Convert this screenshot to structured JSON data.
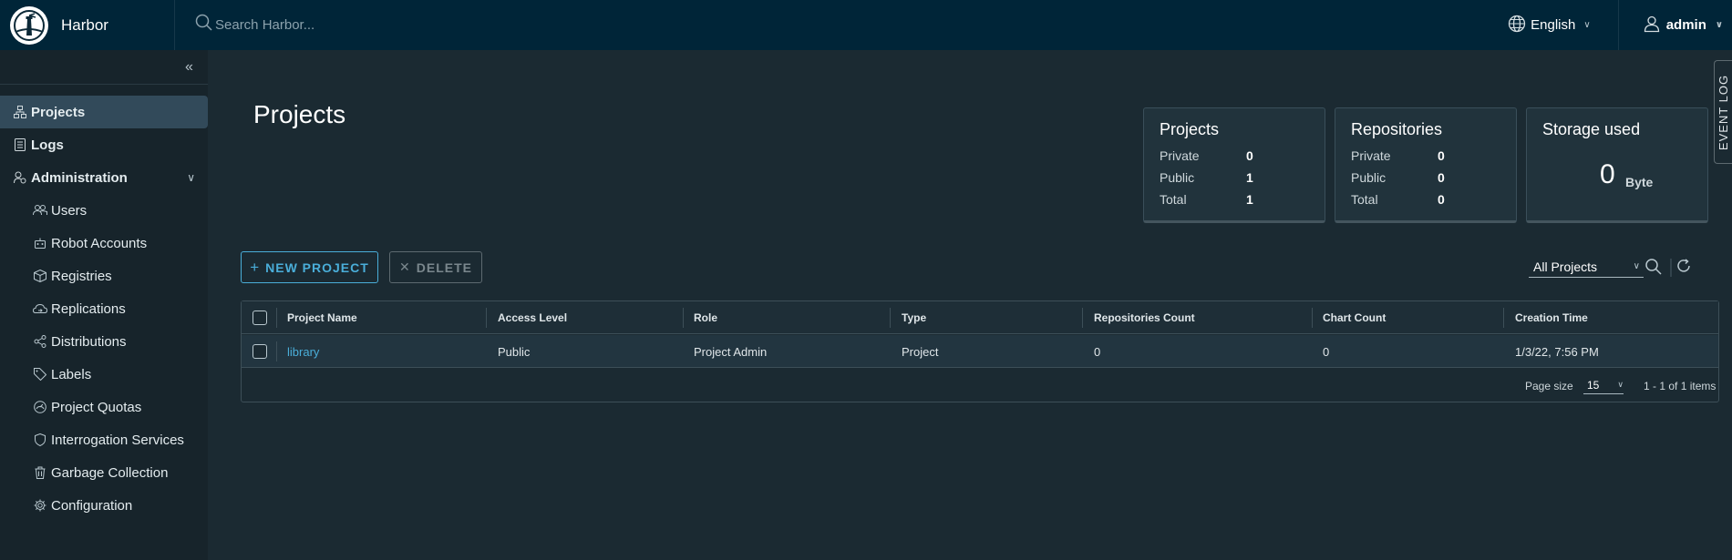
{
  "header": {
    "brand": "Harbor",
    "search_placeholder": "Search Harbor...",
    "language": "English",
    "user": "admin"
  },
  "sidebar": {
    "items": [
      {
        "label": "Projects",
        "icon": "projects-icon",
        "active": true
      },
      {
        "label": "Logs",
        "icon": "logs-icon"
      },
      {
        "label": "Administration",
        "icon": "administration-icon",
        "expanded": true
      },
      {
        "label": "Users",
        "icon": "users-icon"
      },
      {
        "label": "Robot Accounts",
        "icon": "robot-icon"
      },
      {
        "label": "Registries",
        "icon": "registries-icon"
      },
      {
        "label": "Replications",
        "icon": "replications-icon"
      },
      {
        "label": "Distributions",
        "icon": "distributions-icon"
      },
      {
        "label": "Labels",
        "icon": "labels-icon"
      },
      {
        "label": "Project Quotas",
        "icon": "quotas-icon"
      },
      {
        "label": "Interrogation Services",
        "icon": "shield-icon"
      },
      {
        "label": "Garbage Collection",
        "icon": "trash-icon"
      },
      {
        "label": "Configuration",
        "icon": "gear-icon"
      }
    ]
  },
  "main": {
    "title": "Projects",
    "cards": {
      "projects": {
        "title": "Projects",
        "rows": [
          {
            "label": "Private",
            "value": "0"
          },
          {
            "label": "Public",
            "value": "1"
          },
          {
            "label": "Total",
            "value": "1"
          }
        ]
      },
      "repositories": {
        "title": "Repositories",
        "rows": [
          {
            "label": "Private",
            "value": "0"
          },
          {
            "label": "Public",
            "value": "0"
          },
          {
            "label": "Total",
            "value": "0"
          }
        ]
      },
      "storage": {
        "title": "Storage used",
        "value": "0",
        "unit": "Byte"
      }
    },
    "buttons": {
      "new_project": "NEW PROJECT",
      "delete": "DELETE"
    },
    "filter": {
      "selected": "All Projects"
    },
    "table": {
      "columns": [
        "Project Name",
        "Access Level",
        "Role",
        "Type",
        "Repositories Count",
        "Chart Count",
        "Creation Time"
      ],
      "rows": [
        [
          "library",
          "Public",
          "Project Admin",
          "Project",
          "0",
          "0",
          "1/3/22, 7:56 PM"
        ]
      ],
      "footer": {
        "page_size_label": "Page size",
        "page_size": "15",
        "items": "1 - 1 of 1 items"
      }
    }
  },
  "event_log": "EVENT LOG",
  "colors": {
    "header_bg": "#002538",
    "page_bg": "#1b2a32",
    "sidebar_bg": "#17242b",
    "accent": "#4aaed9",
    "active_nav": "#324a5a"
  }
}
